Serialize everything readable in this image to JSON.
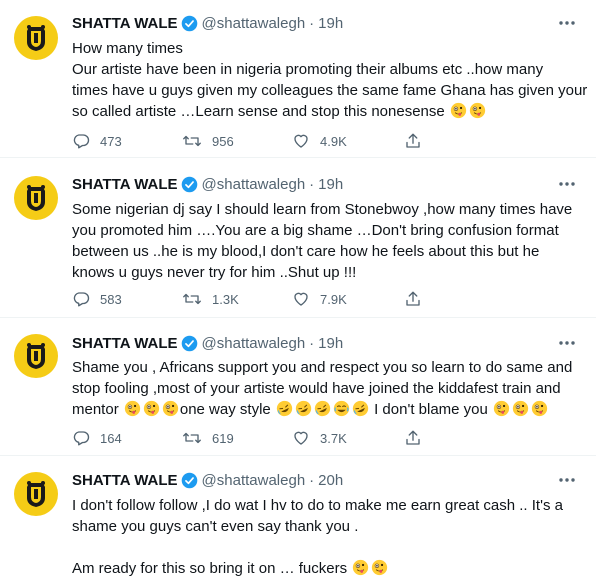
{
  "colors": {
    "accent": "#1d9bf0",
    "muted": "#536471",
    "avatar_bg": "#f5cc16"
  },
  "tweets": [
    {
      "name": "SHATTA WALE",
      "handle": "@shattawalegh",
      "time": "19h",
      "lines": [
        "How many times",
        "Our artiste have been in nigeria promoting their albums etc ..how many",
        "times have u guys given my colleagues the same fame Ghana has given your",
        "so called artiste …Learn sense and stop this nonesense"
      ],
      "emojis": [
        "zany-face-emoji",
        "zany-face-emoji"
      ],
      "replies": "473",
      "retweets": "956",
      "likes": "4.9K"
    },
    {
      "name": "SHATTA WALE",
      "handle": "@shattawalegh",
      "time": "19h",
      "lines": [
        "Some nigerian dj say I should learn from Stonebwoy ,how many times have",
        "you promoted him ….You are a big shame …Don't bring confusion format",
        "between us ..he is my blood,I don't care how he feels about this but he",
        "knows u guys never try for him ..Shut up !!!"
      ],
      "replies": "583",
      "retweets": "1.3K",
      "likes": "7.9K"
    },
    {
      "name": "SHATTA WALE",
      "handle": "@shattawalegh",
      "time": "19h",
      "lines": [
        "Shame you , Africans support you and respect you so learn to do same and",
        "stop fooling ,most of your artiste would have joined the kiddafest train and",
        "mentor",
        "one way style",
        "I don't blame you"
      ],
      "replies": "164",
      "retweets": "619",
      "likes": "3.7K"
    },
    {
      "name": "SHATTA WALE",
      "handle": "@shattawalegh",
      "time": "20h",
      "lines": [
        "I don't follow follow ,I do wat I hv to do to make me earn great cash .. It's a",
        "shame you guys can't even say thank you .",
        "Am ready for this so bring it on … fuckers"
      ]
    }
  ]
}
